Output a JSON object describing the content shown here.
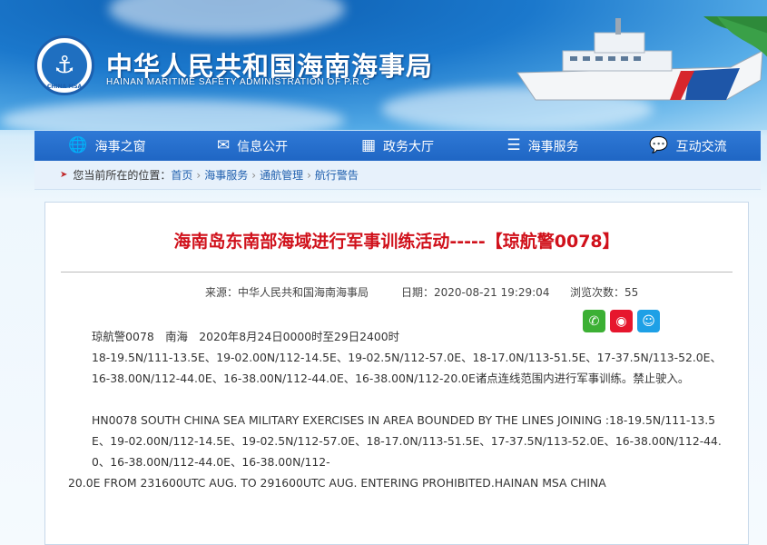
{
  "header": {
    "title": "中华人民共和国海南海事局",
    "subtitle": "HAINAN MARITIME SAFETY ADMINISTRATION OF P.R.C",
    "logo_text": "CHINA MSA"
  },
  "nav": [
    {
      "label": "海事之窗",
      "icon": "globe-icon",
      "glyph": "🌐"
    },
    {
      "label": "信息公开",
      "icon": "mail-icon",
      "glyph": "✉"
    },
    {
      "label": "政务大厅",
      "icon": "grid-icon",
      "glyph": "▦"
    },
    {
      "label": "海事服务",
      "icon": "list-icon",
      "glyph": "☰"
    },
    {
      "label": "互动交流",
      "icon": "chat-icon",
      "glyph": "💬"
    }
  ],
  "breadcrumb": {
    "prefix": "您当前所在的位置：",
    "items": [
      "首页",
      "海事服务",
      "通航管理",
      "航行警告"
    ]
  },
  "article": {
    "title": "海南岛东南部海域进行军事训练活动-----【琼航警0078】",
    "source": "来源：中华人民共和国海南海事局",
    "date": "日期：2020-08-21 19:29:04",
    "views": "浏览次数：55",
    "p1": "琼航警0078　南海　2020年8月24日0000时至29日2400时",
    "p2": "18-19.5N/111-13.5E、19-02.00N/112-14.5E、19-02.5N/112-57.0E、18-17.0N/113-51.5E、17-37.5N/113-52.0E、16-38.00N/112-44.0E、16-38.00N/112-44.0E、16-38.00N/112-20.0E诸点连线范围内进行军事训练。禁止驶入。",
    "p3": "HN0078  SOUTH CHINA SEA MILITARY EXERCISES IN AREA BOUNDED BY THE LINES JOINING :18-19.5N/111-13.5E、19-02.00N/112-14.5E、19-02.5N/112-57.0E、18-17.0N/113-51.5E、17-37.5N/113-52.0E、16-38.00N/112-44.0、16-38.00N/112-44.0E、16-38.00N/112-",
    "p4": "20.0E FROM 231600UTC AUG. TO 291600UTC AUG. ENTERING PROHIBITED.HAINAN MSA CHINA"
  },
  "share": [
    {
      "name": "wechat-icon",
      "color": "#3cb034",
      "glyph": "✆"
    },
    {
      "name": "weibo-icon",
      "color": "#e6162d",
      "glyph": "◉"
    },
    {
      "name": "qq-icon",
      "color": "#1ea0e6",
      "glyph": "☺"
    }
  ]
}
